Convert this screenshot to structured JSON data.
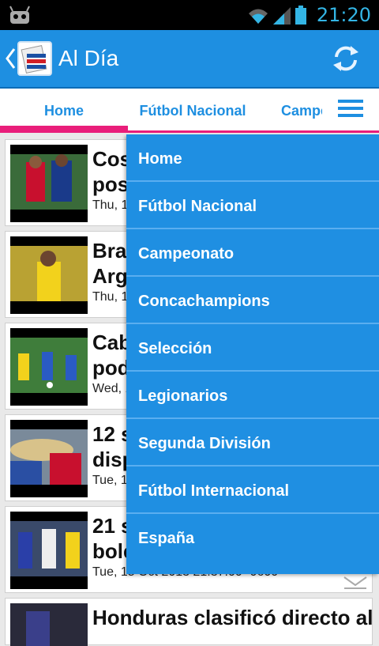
{
  "status": {
    "time": "21:20"
  },
  "actionbar": {
    "title": "Al Día"
  },
  "tabs": [
    {
      "label": "Home"
    },
    {
      "label": "Fútbol Nacional"
    },
    {
      "label": "Campe"
    }
  ],
  "menu": {
    "items": [
      {
        "label": "Home"
      },
      {
        "label": "Fútbol Nacional"
      },
      {
        "label": "Campeonato"
      },
      {
        "label": "Concachampions"
      },
      {
        "label": "Selección"
      },
      {
        "label": "Legionarios"
      },
      {
        "label": "Segunda División"
      },
      {
        "label": "Fútbol Internacional"
      },
      {
        "label": "España"
      }
    ]
  },
  "articles": [
    {
      "title": "Cos\npos",
      "date": "Thu, 1"
    },
    {
      "title": "Bras\nArge",
      "date": "Thu, 1"
    },
    {
      "title": "Cab\npod",
      "date": "Wed, 1"
    },
    {
      "title": "12 s\ndisp",
      "date": "Tue, 1"
    },
    {
      "title": "21 s\nbole",
      "date": "Tue, 15 Oct 2013 21:37:00 -0600"
    },
    {
      "title": "Honduras clasificó directo al",
      "date": ""
    }
  ],
  "colors": {
    "accent": "#1e8fe1",
    "indicator": "#e91e7a",
    "menu_bg": "#1f8fe2"
  }
}
